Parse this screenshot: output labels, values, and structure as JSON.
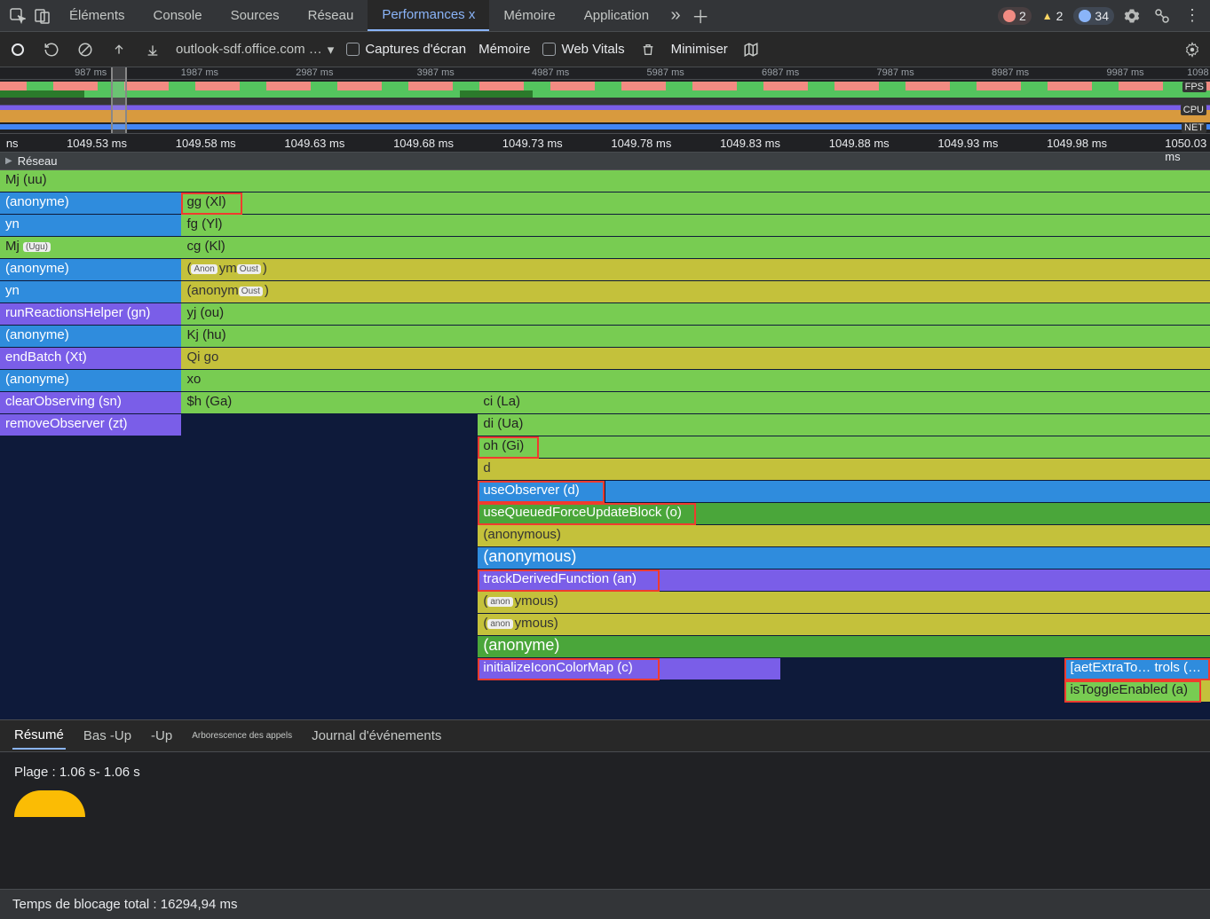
{
  "tabs": {
    "elements": "Éléments",
    "console": "Console",
    "sources": "Sources",
    "network": "Réseau",
    "performance": "Performances x",
    "memory": "Mémoire",
    "application": "Application"
  },
  "badges": {
    "errors": "2",
    "warnings": "2",
    "info": "34"
  },
  "toolbar": {
    "url": "outlook-sdf.office.com …",
    "screenshots": "Captures d'écran",
    "memory": "Mémoire",
    "web_vitals": "Web Vitals",
    "collapse": "Minimiser"
  },
  "overview_ticks": [
    "987 ms",
    "1987 ms",
    "2987 ms",
    "3987 ms",
    "4987 ms",
    "5987 ms",
    "6987 ms",
    "7987 ms",
    "8987 ms",
    "9987 ms",
    "1098"
  ],
  "ov_labels": {
    "fps": "FPS",
    "cpu": "CPU",
    "net": "NET"
  },
  "main_ticks": [
    "ns",
    "1049.53 ms",
    "1049.58 ms",
    "1049.63 ms",
    "1049.68 ms",
    "1049.73 ms",
    "1049.78 ms",
    "1049.83 ms",
    "1049.88 ms",
    "1049.93 ms",
    "1049.98 ms",
    "1050.03 ms"
  ],
  "section_network": "Réseau",
  "flame": {
    "r0": "Mj (uu)",
    "r1a": "(anonyme)",
    "r1b": "gg (Xl)",
    "r2a": "yn",
    "r2b": "fg (Yl)",
    "r3a": "Mj",
    "r3a_chip": "(Ugu)",
    "r3b": "cg (Kl)",
    "r4a": "(anonyme)",
    "r4b_open": "(",
    "r4b_chip1": "Anon",
    "r4b_mid": "ym",
    "r4b_chip2": "Oust",
    "r4b_close": ")",
    "r5a": "yn",
    "r5b": "(anonym",
    "r5b_chip": "Oust",
    "r5b_close": ")",
    "r6a": "runReactionsHelper (gn)",
    "r6b": "yj (ou)",
    "r7a": "(anonyme)",
    "r7b": "Kj (hu)",
    "r8a": "endBatch (Xt)",
    "r8b": "Qi go",
    "r9a": "(anonyme)",
    "r9b": "xo",
    "r10a": "clearObserving (sn)",
    "r10b": "$h (Ga)",
    "r10c": "ci (La)",
    "r11a": "removeObserver (zt)",
    "r11c": "di (Ua)",
    "r12c": "oh (Gi)",
    "r13c": "d",
    "r14c": "useObserver (d)",
    "r15c": "useQueuedForceUpdateBlock (o)",
    "r16c": "(anonymous)",
    "r17c": "(anonymous)",
    "r18c": "trackDerivedFunction (an)",
    "r19c_pre": "(",
    "r19c_chip": "anon",
    "r19c_post": "ymous)",
    "r20c_pre": "(",
    "r20c_chip": "anon",
    "r20c_post": "ymous)",
    "r21c": "(anonyme)",
    "r22c": "initializeIconColorMap (c)",
    "r22d": "[aetExtraTo… trols (co)]",
    "r23d": "isToggleEnabled (a)"
  },
  "bottom_tabs": {
    "summary": "Résumé",
    "bottomup": "Bas -Up",
    "bu2": "-Up",
    "calltree": "Arborescence des appels",
    "eventlog": "Journal d'événements"
  },
  "summary": {
    "range": "Plage : 1.06 s- 1.06 s"
  },
  "footer": "Temps de blocage total : 16294,94 ms"
}
